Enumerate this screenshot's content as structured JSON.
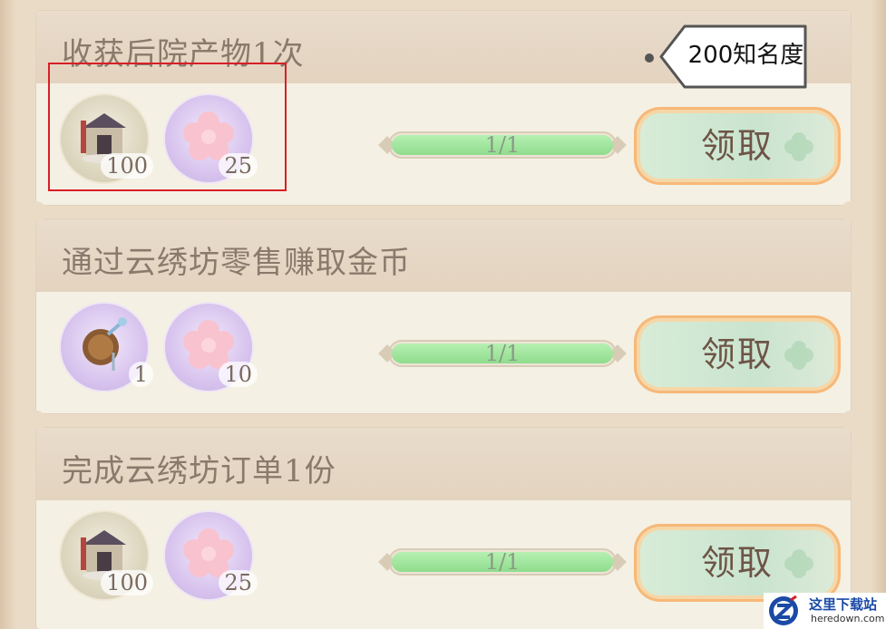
{
  "tasks": [
    {
      "title": "收获后院产物1次",
      "rewards": [
        {
          "type": "house-icon",
          "qty": "100"
        },
        {
          "type": "sakura-icon",
          "qty": "25"
        }
      ],
      "progress_text": "1/1",
      "progress_fraction": 1.0,
      "button_label": "领取"
    },
    {
      "title": "通过云绣坊零售赚取金币",
      "rewards": [
        {
          "type": "fan-icon",
          "qty": "1"
        },
        {
          "type": "sakura-icon",
          "qty": "10"
        }
      ],
      "progress_text": "1/1",
      "progress_fraction": 1.0,
      "button_label": "领取"
    },
    {
      "title": "完成云绣坊订单1份",
      "rewards": [
        {
          "type": "house-icon",
          "qty": "100"
        },
        {
          "type": "sakura-icon",
          "qty": "25"
        }
      ],
      "progress_text": "1/1",
      "progress_fraction": 1.0,
      "button_label": "领取"
    }
  ],
  "annotation": {
    "callout_text": "200知名度",
    "highlight_color": "#d81f26"
  },
  "watermark": {
    "name": "这里下载站",
    "url": "heredown.com"
  },
  "colors": {
    "progress_fill": "#8fdc8d",
    "button_glow": "#f7b878",
    "button_text": "#6e5447"
  }
}
